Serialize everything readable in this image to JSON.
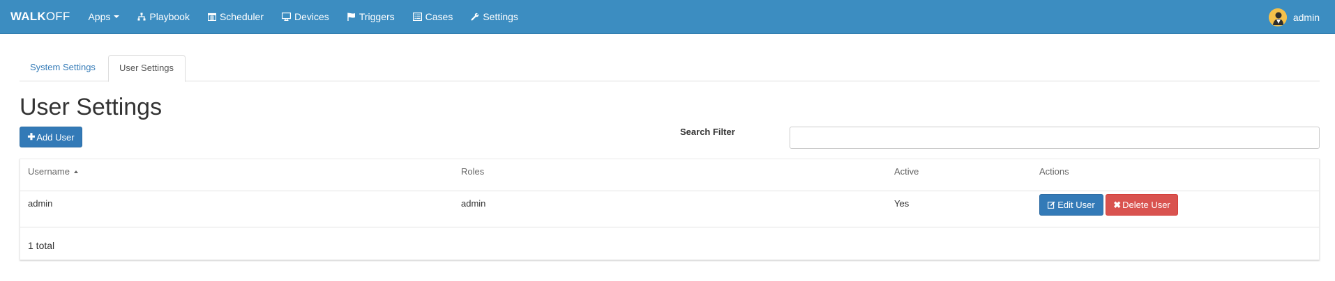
{
  "navbar": {
    "brand_bold": "WALK",
    "brand_light": "OFF",
    "items": [
      {
        "label": "Apps",
        "icon": "none",
        "dropdown": true
      },
      {
        "label": "Playbook",
        "icon": "sitemap-icon"
      },
      {
        "label": "Scheduler",
        "icon": "calendar-icon"
      },
      {
        "label": "Devices",
        "icon": "desktop-icon"
      },
      {
        "label": "Triggers",
        "icon": "flag-icon"
      },
      {
        "label": "Cases",
        "icon": "list-alt-icon"
      },
      {
        "label": "Settings",
        "icon": "wrench-icon"
      }
    ],
    "user": "admin",
    "bg_color": "#3c8dc1"
  },
  "tabs": [
    {
      "label": "System Settings",
      "active": false
    },
    {
      "label": "User Settings",
      "active": true
    }
  ],
  "page": {
    "title": "User Settings",
    "add_user_label": "Add User",
    "search_label": "Search Filter",
    "search_value": ""
  },
  "table": {
    "columns": [
      "Username",
      "Roles",
      "Active",
      "Actions"
    ],
    "sort_column": "Username",
    "rows": [
      {
        "username": "admin",
        "roles": "admin",
        "active": "Yes",
        "edit_label": "Edit User",
        "delete_label": "Delete User"
      }
    ],
    "total_text": "1 total"
  },
  "colors": {
    "primary": "#337ab7",
    "danger": "#d9534f"
  }
}
